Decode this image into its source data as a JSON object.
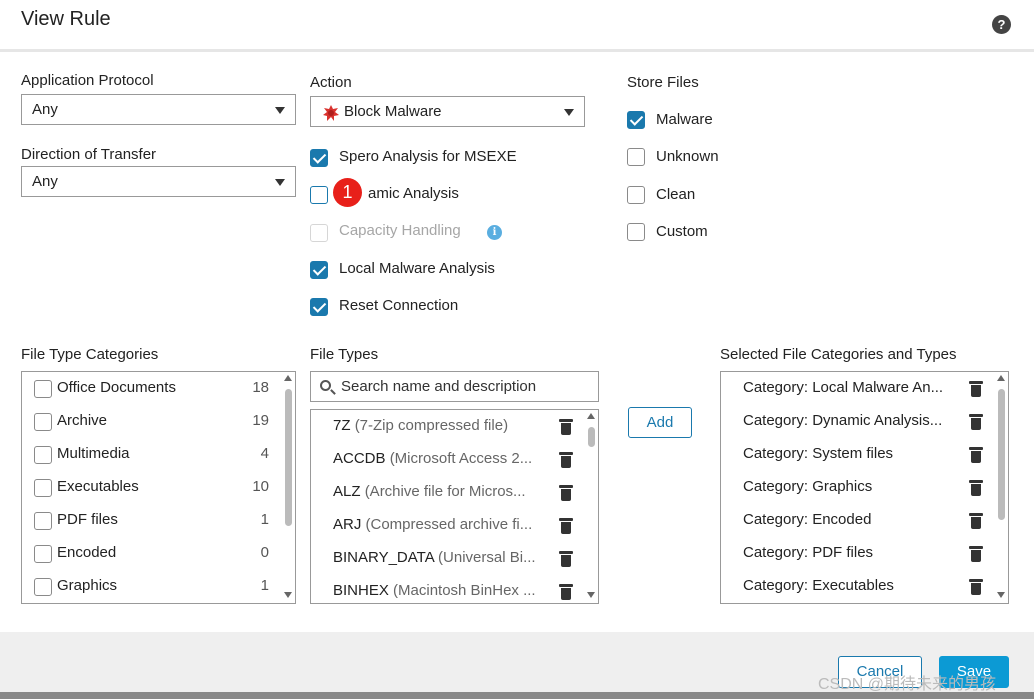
{
  "title": "View Rule",
  "help_icon": "?",
  "application_protocol": {
    "label": "Application Protocol",
    "value": "Any"
  },
  "direction": {
    "label": "Direction of Transfer",
    "value": "Any"
  },
  "action": {
    "label": "Action",
    "value": "Block Malware",
    "icon": "malware-icon"
  },
  "options": [
    {
      "label": "Spero Analysis for MSEXE",
      "checked": true
    },
    {
      "label": "Dynamic Analysis",
      "visible_label": "amic Analysis",
      "checked": false
    },
    {
      "label": "Capacity Handling",
      "checked": false,
      "disabled": true
    },
    {
      "label": "Local Malware Analysis",
      "checked": true
    },
    {
      "label": "Reset Connection",
      "checked": true
    }
  ],
  "annotation_badge": "1",
  "store_files": {
    "label": "Store Files",
    "items": [
      {
        "label": "Malware",
        "checked": true
      },
      {
        "label": "Unknown",
        "checked": false
      },
      {
        "label": "Clean",
        "checked": false
      },
      {
        "label": "Custom",
        "checked": false
      }
    ]
  },
  "file_type_categories": {
    "label": "File Type Categories",
    "items": [
      {
        "label": "Office Documents",
        "count": "18"
      },
      {
        "label": "Archive",
        "count": "19"
      },
      {
        "label": "Multimedia",
        "count": "4"
      },
      {
        "label": "Executables",
        "count": "10"
      },
      {
        "label": "PDF files",
        "count": "1"
      },
      {
        "label": "Encoded",
        "count": "0"
      },
      {
        "label": "Graphics",
        "count": "1"
      }
    ]
  },
  "file_types": {
    "label": "File Types",
    "search_placeholder": "Search name and description",
    "items": [
      {
        "name": "7Z",
        "desc": "(7-Zip compressed file)"
      },
      {
        "name": "ACCDB",
        "desc": "(Microsoft Access 2..."
      },
      {
        "name": "ALZ",
        "desc": "(Archive file for Micros..."
      },
      {
        "name": "ARJ",
        "desc": "(Compressed archive fi..."
      },
      {
        "name": "BINARY_DATA",
        "desc": "(Universal Bi..."
      },
      {
        "name": "BINHEX",
        "desc": "(Macintosh BinHex ..."
      }
    ]
  },
  "add_button": "Add",
  "selected": {
    "label": "Selected File Categories and Types",
    "items": [
      "Category: Local Malware An...",
      "Category: Dynamic Analysis...",
      "Category: System files",
      "Category: Graphics",
      "Category: Encoded",
      "Category: PDF files",
      "Category: Executables"
    ]
  },
  "footer": {
    "cancel": "Cancel",
    "save": "Save"
  },
  "watermark": "CSDN @期待未来的男孩"
}
